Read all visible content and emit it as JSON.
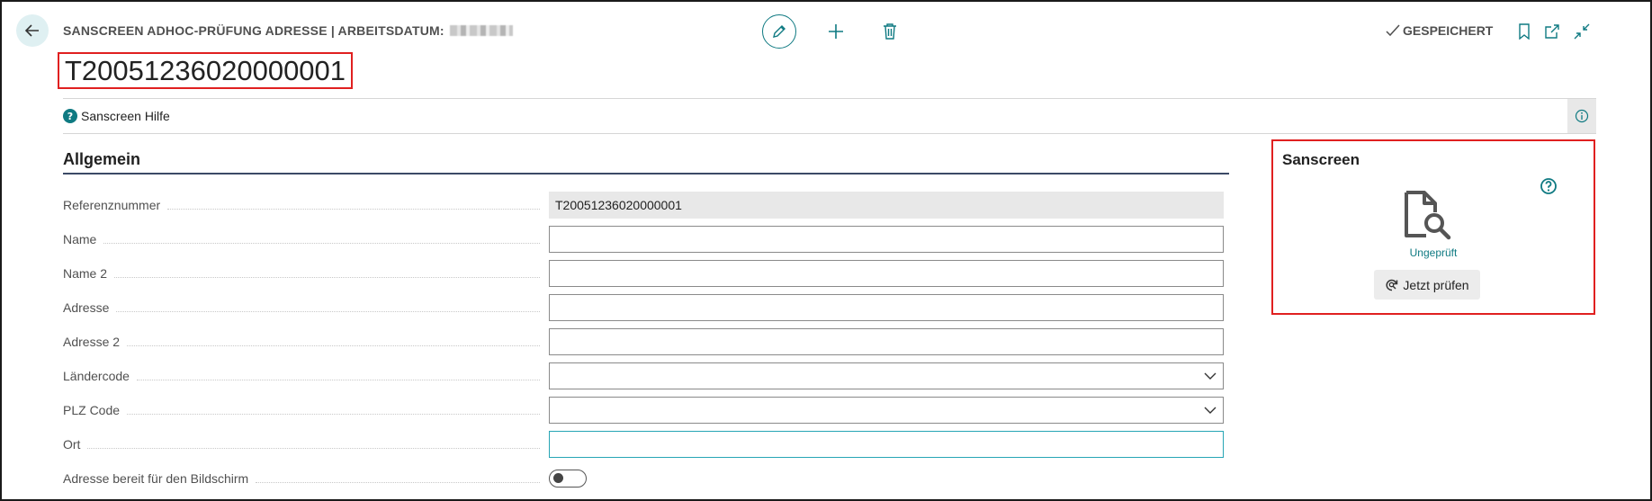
{
  "header": {
    "caption": "SANSCREEN ADHOC-PRÜFUNG ADRESSE | ARBEITSDATUM:",
    "record_title": "T20051236020000001",
    "saved_label": "GESPEICHERT",
    "icons": {
      "back": "arrow-left-icon",
      "edit": "pencil-icon",
      "new": "plus-icon",
      "delete": "trash-icon",
      "saved": "checkmark-icon",
      "bookmark": "bookmark-icon",
      "open_new": "open-in-new-window-icon",
      "collapse": "collapse-icon"
    },
    "accent_color": "#0f7a82"
  },
  "helpbar": {
    "help_label": "Sanscreen Hilfe",
    "help_icon": "question-circle-icon",
    "info_icon": "info-icon"
  },
  "section": {
    "title": "Allgemein"
  },
  "fields": {
    "referenznummer": {
      "label": "Referenznummer",
      "value": "T20051236020000001"
    },
    "name": {
      "label": "Name",
      "value": ""
    },
    "name2": {
      "label": "Name 2",
      "value": ""
    },
    "adresse": {
      "label": "Adresse",
      "value": ""
    },
    "adresse2": {
      "label": "Adresse 2",
      "value": ""
    },
    "laendercode": {
      "label": "Ländercode",
      "value": ""
    },
    "plz": {
      "label": "PLZ Code",
      "value": ""
    },
    "ort": {
      "label": "Ort",
      "value": ""
    },
    "bereit": {
      "label": "Adresse bereit für den Bildschirm",
      "value": false
    }
  },
  "factbox": {
    "title": "Sanscreen",
    "status": "Ungeprüft",
    "check_button": "Jetzt prüfen",
    "help_icon": "question-circle-icon",
    "doc_icon": "document-search-icon",
    "check_icon": "refresh-search-icon"
  }
}
